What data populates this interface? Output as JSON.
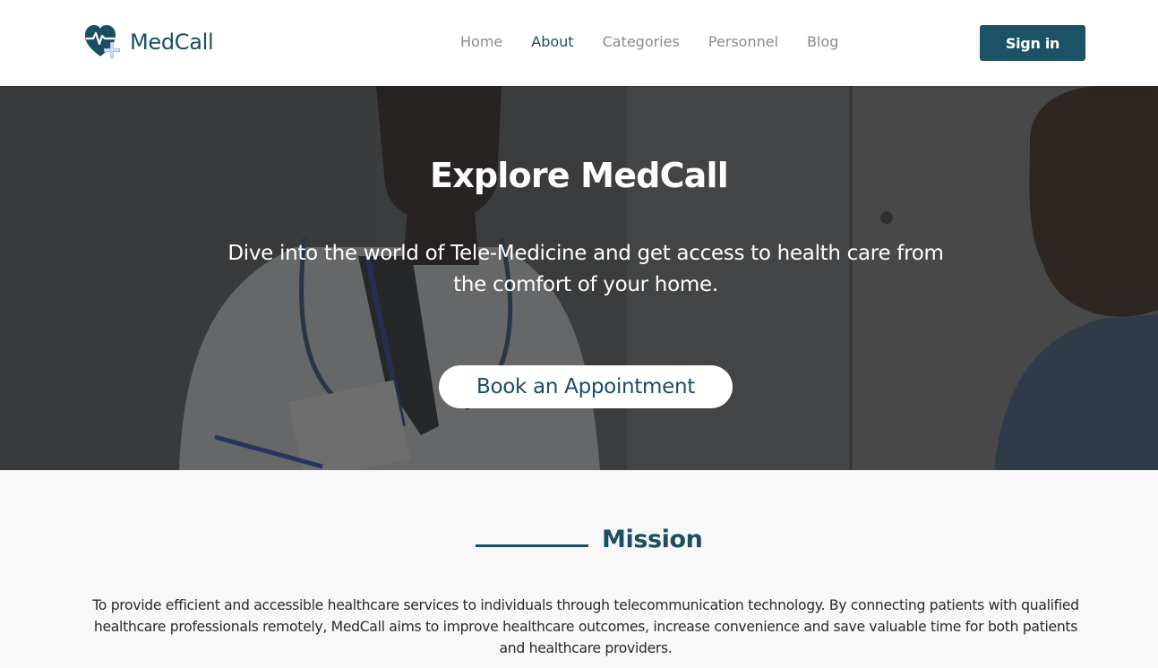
{
  "brand": {
    "name": "MedCall",
    "logo_icon": "heart-pulse-plus-icon",
    "color": "#1b4d63"
  },
  "nav": {
    "items": [
      {
        "label": "Home",
        "active": false
      },
      {
        "label": "About",
        "active": true
      },
      {
        "label": "Categories",
        "active": false
      },
      {
        "label": "Personnel",
        "active": false
      },
      {
        "label": "Blog",
        "active": false
      }
    ],
    "signin_label": "Sign in"
  },
  "hero": {
    "title": "Explore MedCall",
    "subtitle": "Dive into the world of Tele-Medicine and get access to health care from the comfort of your home.",
    "cta_label": "Book an Appointment",
    "background": "doctor-with-stethoscope-and-patient-photo"
  },
  "mission": {
    "title": "Mission",
    "text": "To provide efficient and accessible healthcare services to individuals through telecommunication technology. By connecting patients with qualified healthcare professionals remotely, MedCall aims to improve healthcare outcomes, increase convenience and save valuable time for both patients and healthcare providers."
  },
  "colors": {
    "primary": "#1b4d63",
    "button": "#1b5265",
    "nav_inactive": "#8a8a8a",
    "page_bg": "#f8f8f8"
  }
}
